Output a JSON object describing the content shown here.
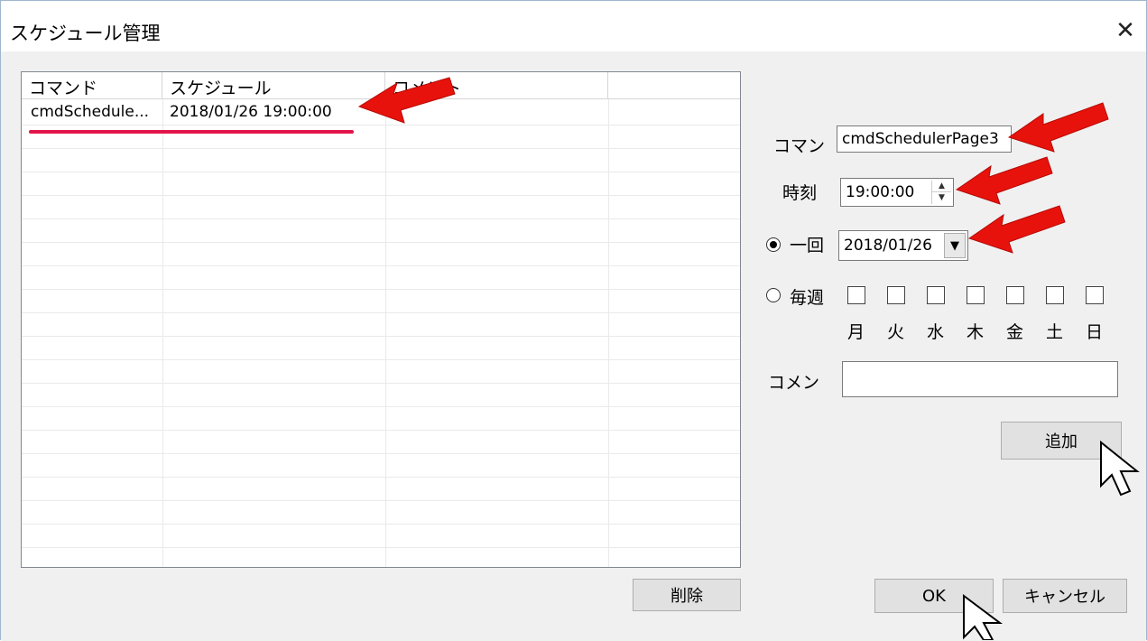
{
  "window": {
    "title": "スケジュール管理"
  },
  "list": {
    "columns": [
      "コマンド",
      "スケジュール",
      "コメント",
      ""
    ],
    "rows": [
      {
        "command": "cmdSchedule...",
        "schedule": "2018/01/26 19:00:00",
        "comment": ""
      }
    ]
  },
  "form": {
    "command_label": "コマン",
    "command_value": "cmdSchedulerPage3",
    "time_label": "時刻",
    "time_value": "19:00:00",
    "once_label": "一回",
    "once_date": "2018/01/26",
    "weekly_label": "毎週",
    "days": [
      "月",
      "火",
      "水",
      "木",
      "金",
      "土",
      "日"
    ],
    "comment_label": "コメン",
    "comment_value": "",
    "schedule_mode": "once"
  },
  "buttons": {
    "add": "追加",
    "delete": "削除",
    "ok": "OK",
    "cancel": "キャンセル"
  },
  "annotations": {
    "arrow_color": "#e8120c",
    "underline_color": "#e2154a"
  }
}
